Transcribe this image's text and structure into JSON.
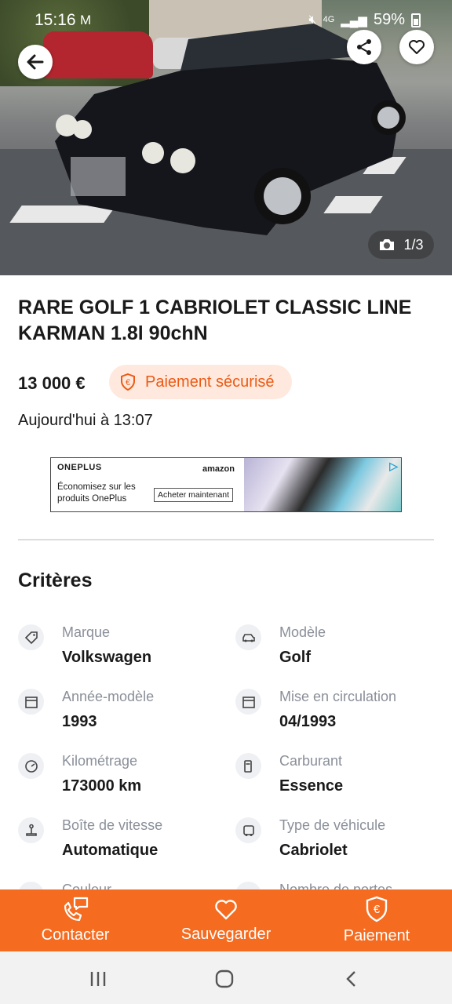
{
  "status_bar": {
    "time": "15:16",
    "network": "4G",
    "battery": "59%"
  },
  "gallery": {
    "counter": "1/3"
  },
  "listing": {
    "title": "RARE GOLF 1 CABRIOLET CLASSIC LINE KARMAN 1.8l 90chN",
    "price": "13 000 €",
    "secure_payment_label": "Paiement sécurisé",
    "posted": "Aujourd'hui à 13:07"
  },
  "ad": {
    "brand": "ONEPLUS",
    "retailer": "amazon",
    "copy": "Économisez sur les produits OnePlus",
    "cta": "Acheter maintenant"
  },
  "criteria": {
    "heading": "Critères",
    "items": [
      {
        "label": "Marque",
        "value": "Volkswagen",
        "icon": "tag-icon"
      },
      {
        "label": "Modèle",
        "value": "Golf",
        "icon": "car-icon"
      },
      {
        "label": "Année-modèle",
        "value": "1993",
        "icon": "calendar-icon"
      },
      {
        "label": "Mise en circulation",
        "value": "04/1993",
        "icon": "calendar-icon"
      },
      {
        "label": "Kilométrage",
        "value": "173000 km",
        "icon": "speedometer-icon"
      },
      {
        "label": "Carburant",
        "value": "Essence",
        "icon": "fuel-icon"
      },
      {
        "label": "Boîte de vitesse",
        "value": "Automatique",
        "icon": "gearshift-icon"
      },
      {
        "label": "Type de véhicule",
        "value": "Cabriolet",
        "icon": "vehicle-type-icon"
      },
      {
        "label": "Couleur",
        "value": "",
        "icon": "palette-icon"
      },
      {
        "label": "Nombre de portes",
        "value": "",
        "icon": "door-icon"
      }
    ]
  },
  "actions": {
    "contact": "Contacter",
    "save": "Sauvegarder",
    "payment": "Paiement"
  },
  "colors": {
    "accent": "#f56b1f",
    "secure_bg": "#ffe9de",
    "secure_text": "#ec5a13"
  }
}
